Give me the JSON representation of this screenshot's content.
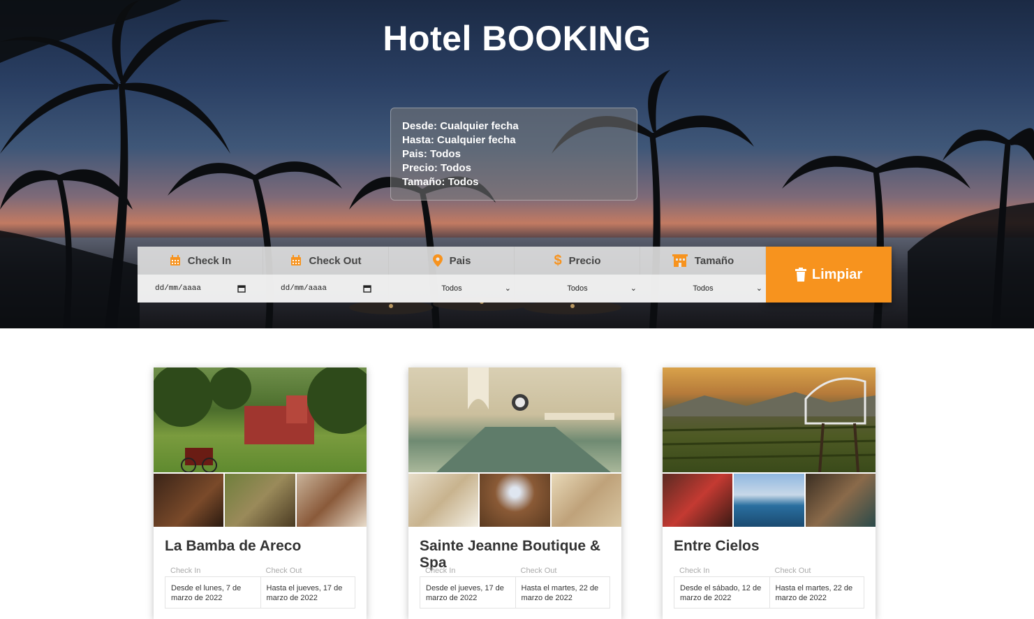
{
  "hero": {
    "title": "Hotel BOOKING",
    "summary": {
      "desde_label": "Desde:",
      "desde_value": "Cualquier fecha",
      "hasta_label": "Hasta:",
      "hasta_value": "Cualquier fecha",
      "pais_label": "Pais:",
      "pais_value": "Todos",
      "precio_label": "Precio:",
      "precio_value": "Todos",
      "tamano_label": "Tamaño:",
      "tamano_value": "Todos"
    }
  },
  "filters": {
    "checkin": {
      "label": "Check In",
      "icon": "calendar-icon",
      "placeholder": "dd/mm/aaaa"
    },
    "checkout": {
      "label": "Check Out",
      "icon": "calendar-icon",
      "placeholder": "dd/mm/aaaa"
    },
    "pais": {
      "label": "Pais",
      "icon": "map-pin-icon",
      "selected": "Todos"
    },
    "precio": {
      "label": "Precio",
      "icon": "dollar-icon",
      "selected": "Todos"
    },
    "tamano": {
      "label": "Tamaño",
      "icon": "hotel-icon",
      "selected": "Todos"
    },
    "clear_label": "Limpiar",
    "accent_color": "#f7931e"
  },
  "hotels": [
    {
      "name": "La Bamba de Areco",
      "checkin_label": "Check In",
      "checkout_label": "Check Out",
      "checkin": "Desde el lunes, 7 de marzo de 2022",
      "checkout": "Hasta el jueves, 17 de marzo de 2022"
    },
    {
      "name": "Sainte Jeanne Boutique & Spa",
      "checkin_label": "Check In",
      "checkout_label": "Check Out",
      "checkin": "Desde el jueves, 17 de marzo de 2022",
      "checkout": "Hasta el martes, 22 de marzo de 2022"
    },
    {
      "name": "Entre Cielos",
      "checkin_label": "Check In",
      "checkout_label": "Check Out",
      "checkin": "Desde el sábado, 12 de marzo de 2022",
      "checkout": "Hasta el martes, 22 de marzo de 2022"
    }
  ]
}
